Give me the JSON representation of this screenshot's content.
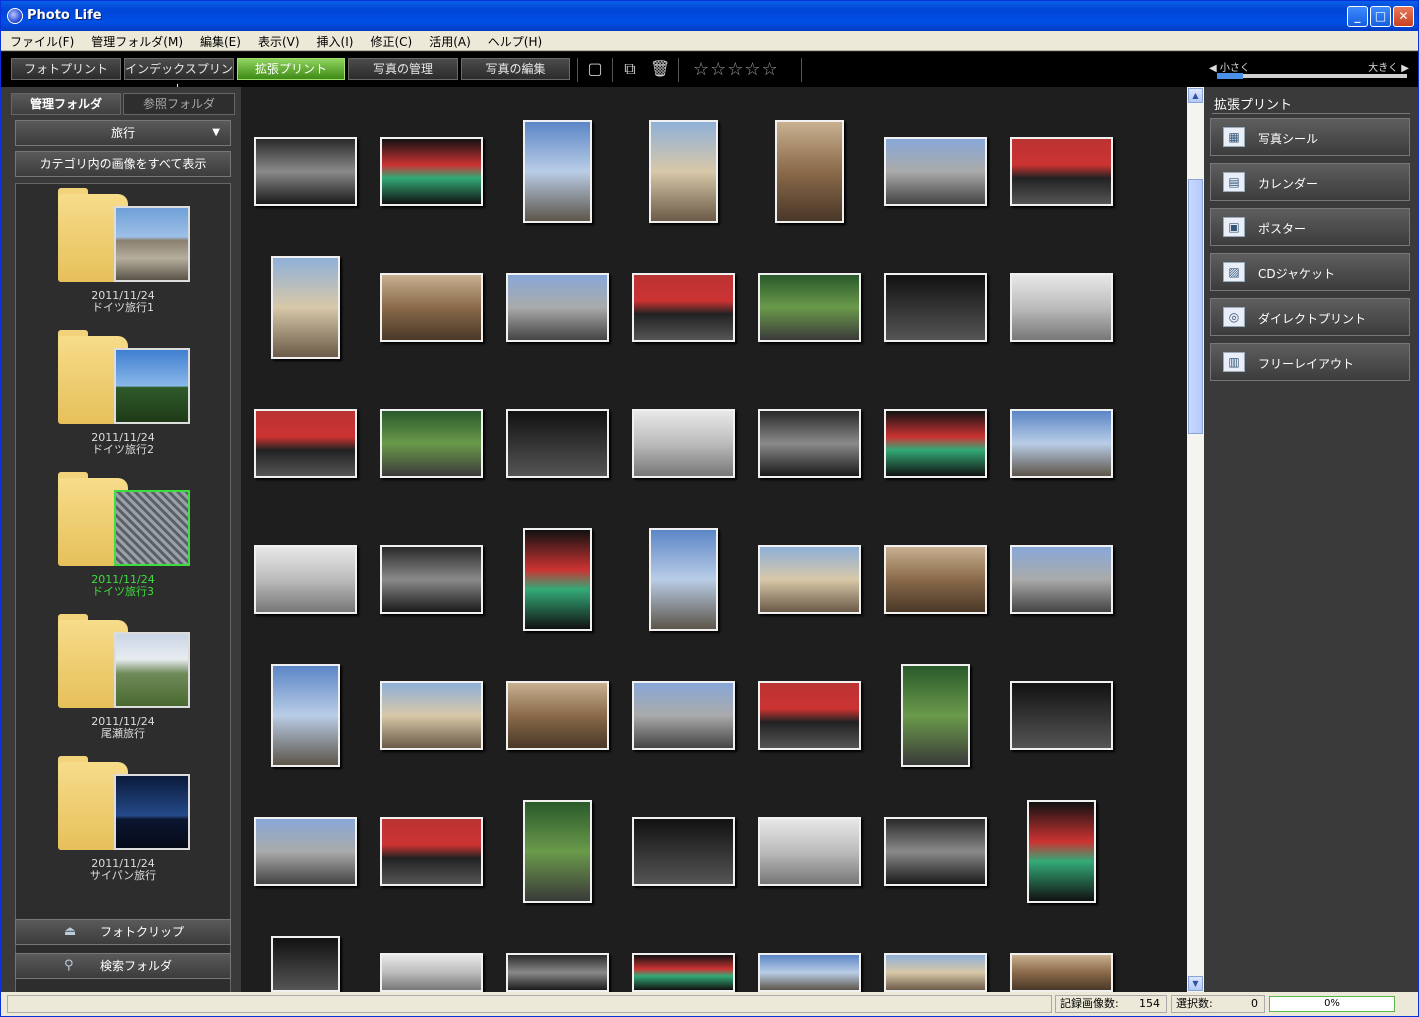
{
  "window": {
    "title": "Photo Life",
    "min": "_",
    "max": "□",
    "close": "✕"
  },
  "menu": [
    "ファイル(F)",
    "管理フォルダ(M)",
    "編集(E)",
    "表示(V)",
    "挿入(I)",
    "修正(C)",
    "活用(A)",
    "ヘルプ(H)"
  ],
  "toolbar": {
    "tabs": [
      "フォトプリント",
      "インデックスプリント",
      "拡張プリント",
      "写真の管理",
      "写真の編集"
    ],
    "active": "拡張プリント",
    "stars": "☆☆☆☆☆",
    "size_small": "◀ 小さく",
    "size_large": "大きく ▶",
    "size_level": 0.1
  },
  "left": {
    "tab_managed": "管理フォルダ",
    "tab_reference": "参照フォルダ",
    "category": "旅行",
    "show_all": "カテゴリ内の画像をすべて表示",
    "folders": [
      {
        "date": "2011/11/24",
        "name": "ドイツ旅行1"
      },
      {
        "date": "2011/11/24",
        "name": "ドイツ旅行2"
      },
      {
        "date": "2011/11/24",
        "name": "ドイツ旅行3"
      },
      {
        "date": "2011/11/24",
        "name": "尾瀬旅行"
      },
      {
        "date": "2011/11/24",
        "name": "サイパン旅行"
      }
    ],
    "photoclip": "フォトクリップ",
    "search": "検索フォルダ"
  },
  "right": {
    "title": "拡張プリント",
    "buttons": [
      "写真シール",
      "カレンダー",
      "ポスター",
      "CDジャケット",
      "ダイレクトプリント",
      "フリーレイアウト"
    ]
  },
  "status": {
    "count_label": "記録画像数:",
    "count": "154",
    "selected_label": "選択数:",
    "selected": "0",
    "progress": "0%"
  },
  "colors": {
    "accent": "#3fdc3f",
    "active_tab": "#5aa82a",
    "titlebar": "#0050e6"
  }
}
